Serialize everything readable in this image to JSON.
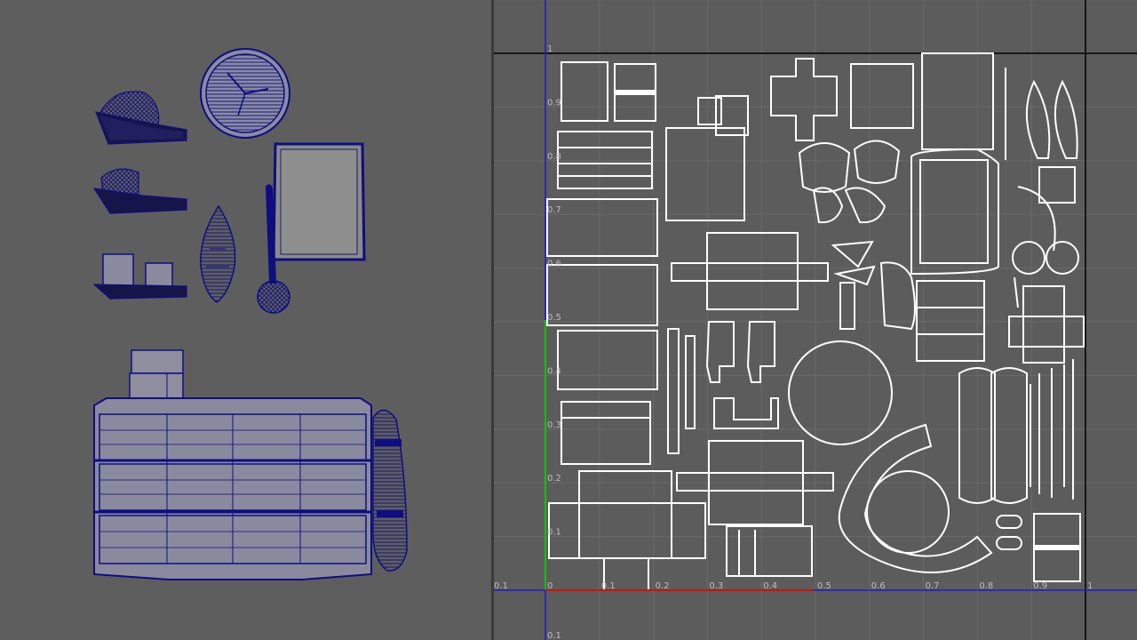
{
  "viewport": {
    "objects": [
      {
        "name": "shelf-with-shoes"
      },
      {
        "name": "wall-clock"
      },
      {
        "name": "shelf-with-books"
      },
      {
        "name": "picture-frame"
      },
      {
        "name": "hanging-basket"
      },
      {
        "name": "hand-mirror"
      },
      {
        "name": "shelf-with-boxes"
      },
      {
        "name": "stacked-boxes"
      },
      {
        "name": "chest-of-drawers"
      },
      {
        "name": "rolled-cushion"
      }
    ],
    "colors": {
      "background": "#5e5e5e",
      "wire": "#0e0e80",
      "surface": "#8a8a9e"
    }
  },
  "uv_editor": {
    "colors": {
      "background": "#5c5c5c",
      "grid": "#6a6a6a",
      "uv_lines": "#ffffff",
      "u_axis": "#d01010",
      "v_axis": "#10c010",
      "frame": "#1c1cd0",
      "border": "#000000"
    },
    "u_ticks": [
      "0.1",
      "0",
      "0.1",
      "0.2",
      "0.3",
      "0.4",
      "0.5",
      "0.6",
      "0.7",
      "0.8",
      "0.9",
      "1"
    ],
    "v_ticks": [
      "1",
      "0.9",
      "0.8",
      "0.7",
      "0.6",
      "0.5",
      "0.4",
      "0.3",
      "0.2",
      "0.1",
      "0.1"
    ]
  }
}
